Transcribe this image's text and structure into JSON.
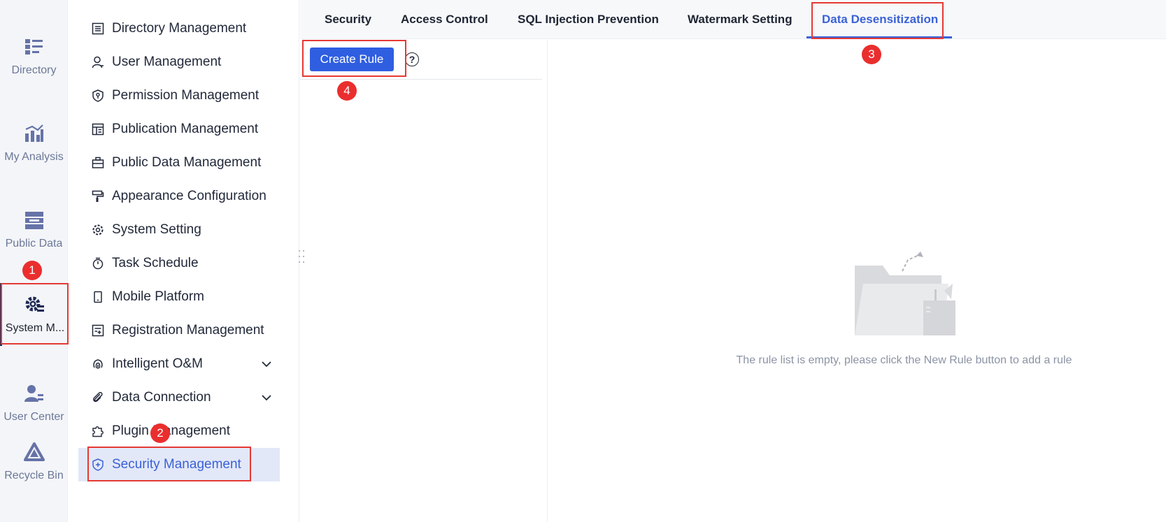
{
  "rail": {
    "items": [
      {
        "label": "Directory",
        "icon": "directory-icon"
      },
      {
        "label": "My Analysis",
        "icon": "analysis-chart-icon"
      },
      {
        "label": "Public Data",
        "icon": "public-data-icon"
      },
      {
        "label": "System M...",
        "icon": "system-gear-icon",
        "active": true
      },
      {
        "label": "User Center",
        "icon": "user-center-icon"
      },
      {
        "label": "Recycle Bin",
        "icon": "recycle-bin-icon"
      }
    ]
  },
  "menu": {
    "items": [
      {
        "label": "Directory Management",
        "icon": "list-icon"
      },
      {
        "label": "User Management",
        "icon": "user-icon"
      },
      {
        "label": "Permission Management",
        "icon": "shield-key-icon"
      },
      {
        "label": "Publication Management",
        "icon": "layout-icon"
      },
      {
        "label": "Public Data Management",
        "icon": "briefcase-icon"
      },
      {
        "label": "Appearance Configuration",
        "icon": "paint-roller-icon"
      },
      {
        "label": "System Setting",
        "icon": "gear-icon"
      },
      {
        "label": "Task Schedule",
        "icon": "stopwatch-icon"
      },
      {
        "label": "Mobile Platform",
        "icon": "mobile-icon"
      },
      {
        "label": "Registration Management",
        "icon": "registration-icon"
      },
      {
        "label": "Intelligent O&M",
        "icon": "fingerprint-icon",
        "expandable": true
      },
      {
        "label": "Data Connection",
        "icon": "paperclip-icon",
        "expandable": true
      },
      {
        "label": "Plugin Management",
        "icon": "puzzle-icon"
      },
      {
        "label": "Security Management",
        "icon": "shield-plus-icon",
        "active": true
      }
    ]
  },
  "tabs": [
    {
      "label": "Security"
    },
    {
      "label": "Access Control"
    },
    {
      "label": "SQL Injection Prevention"
    },
    {
      "label": "Watermark Setting"
    },
    {
      "label": "Data Desensitization",
      "active": true
    }
  ],
  "toolbar": {
    "create_label": "Create Rule",
    "help_symbol": "?"
  },
  "empty_state": {
    "message": "The rule list is empty, please click the New Rule button to add a rule"
  },
  "annotations": [
    "1",
    "2",
    "3",
    "4"
  ],
  "colors": {
    "accent": "#3a62d6",
    "primary_button": "#2f5ee0",
    "annotation_red": "#e53935",
    "rail_bg": "#f4f5f8",
    "active_menu_bg": "#e3e8f8"
  }
}
